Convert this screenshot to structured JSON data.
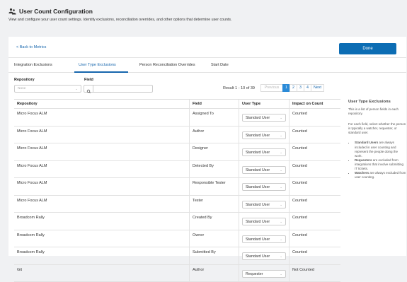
{
  "header": {
    "title": "User Count Configuration",
    "subtitle": "View and configure your user count settings. Identify exclusions, reconciliation overrides, and other options that determine user counts."
  },
  "toolbar": {
    "back_label": "< Back to Metrics",
    "done_label": "Done"
  },
  "tabs": [
    {
      "label": "Integration Exclusions",
      "active": false
    },
    {
      "label": "User Type Exclusions",
      "active": true
    },
    {
      "label": "Person Reconciliation Overrides",
      "active": false
    },
    {
      "label": "Start Date",
      "active": false
    }
  ],
  "filters": {
    "repository_label": "Repository",
    "repository_placeholder": "None",
    "field_label": "Field",
    "field_value": ""
  },
  "results": {
    "summary": "Result 1 - 10 of 39",
    "pager": [
      "Previous",
      "1",
      "2",
      "3",
      "4",
      "Next"
    ],
    "current_page": "1"
  },
  "table": {
    "columns": [
      "Repository",
      "Field",
      "User Type",
      "Impact on Count"
    ],
    "rows": [
      [
        "Micro Focus ALM",
        "Assigned To",
        "Standard User",
        "Counted"
      ],
      [
        "Micro Focus ALM",
        "Author",
        "Standard User",
        "Counted"
      ],
      [
        "Micro Focus ALM",
        "Designer",
        "Standard User",
        "Counted"
      ],
      [
        "Micro Focus ALM",
        "Detected By",
        "Standard User",
        "Counted"
      ],
      [
        "Micro Focus ALM",
        "Responsible Tester",
        "Standard User",
        "Counted"
      ],
      [
        "Micro Focus ALM",
        "Tester",
        "Standard User",
        "Counted"
      ],
      [
        "Broadcom Rally",
        "Created By",
        "Standard User",
        "Counted"
      ],
      [
        "Broadcom Rally",
        "Owner",
        "Standard User",
        "Counted"
      ],
      [
        "Broadcom Rally",
        "Submitted By",
        "Standard User",
        "Counted"
      ],
      [
        "Git",
        "Author",
        "Requester",
        "Not Counted"
      ]
    ]
  },
  "sidebar": {
    "title": "User Type Exclusions",
    "intro": "This is a list of person fields in each repository.",
    "instruction": "For each field, select whether the person is typically a watcher, requester, or standard user.",
    "bullets": [
      {
        "term": "Standard Users",
        "text": " are always included in user counting and represent the people doing the work."
      },
      {
        "term": "Requesters",
        "text": " are excluded from integrations that involve submitting IT tickets."
      },
      {
        "term": "Watchers",
        "text": " are always excluded from user counting."
      }
    ]
  },
  "colors": {
    "accent": "#1666ad",
    "primary_button": "#0c6db4",
    "active_page": "#2b8bd8",
    "background": "#f0f1f3"
  },
  "icons": [
    "users-icon",
    "chevron-down-icon",
    "search-icon"
  ]
}
